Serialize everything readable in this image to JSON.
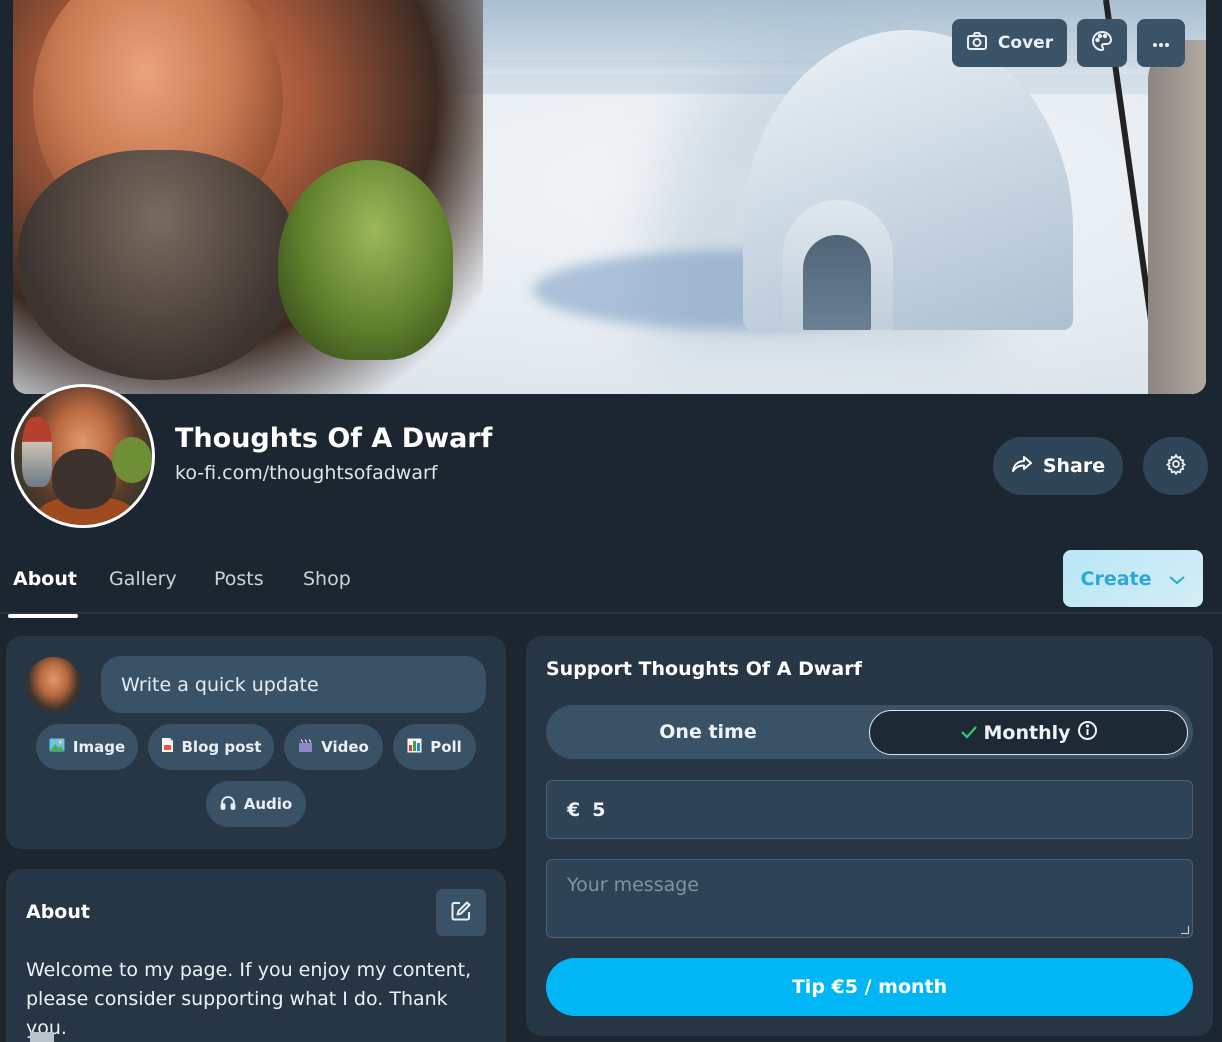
{
  "cover": {
    "cover_button_label": "Cover",
    "cover_button_icon": "camera-icon",
    "theme_button_icon": "palette-icon",
    "more_button_icon": "more-horizontal-icon"
  },
  "profile": {
    "name": "Thoughts Of A Dwarf",
    "url": "ko-fi.com/thoughtsofadwarf",
    "share_label": "Share",
    "share_icon": "share-arrow-icon",
    "settings_icon": "gear-icon"
  },
  "tabs": [
    {
      "label": "About",
      "active": true
    },
    {
      "label": "Gallery",
      "active": false
    },
    {
      "label": "Posts",
      "active": false
    },
    {
      "label": "Shop",
      "active": false
    }
  ],
  "create": {
    "label": "Create",
    "icon": "chevron-down-icon"
  },
  "update": {
    "placeholder": "Write a quick update",
    "chips": [
      {
        "label": "Image",
        "icon": "image-icon"
      },
      {
        "label": "Blog post",
        "icon": "document-icon"
      },
      {
        "label": "Video",
        "icon": "clapperboard-icon"
      },
      {
        "label": "Poll",
        "icon": "bar-chart-icon"
      },
      {
        "label": "Audio",
        "icon": "headphones-icon"
      }
    ]
  },
  "about": {
    "title": "About",
    "text": "Welcome to my page. If you enjoy my content, please consider supporting what I do. Thank you."
  },
  "support": {
    "title": "Support Thoughts Of A Dwarf",
    "one_time_label": "One time",
    "monthly_label": "Monthly",
    "selected_frequency": "Monthly",
    "currency_symbol": "€",
    "amount": "5",
    "message_placeholder": "Your message",
    "tip_button_label": "Tip €5 / month"
  },
  "colors": {
    "background": "#1b2631",
    "card": "#273644",
    "accent": "#00b6f5",
    "check": "#2ecc71"
  }
}
